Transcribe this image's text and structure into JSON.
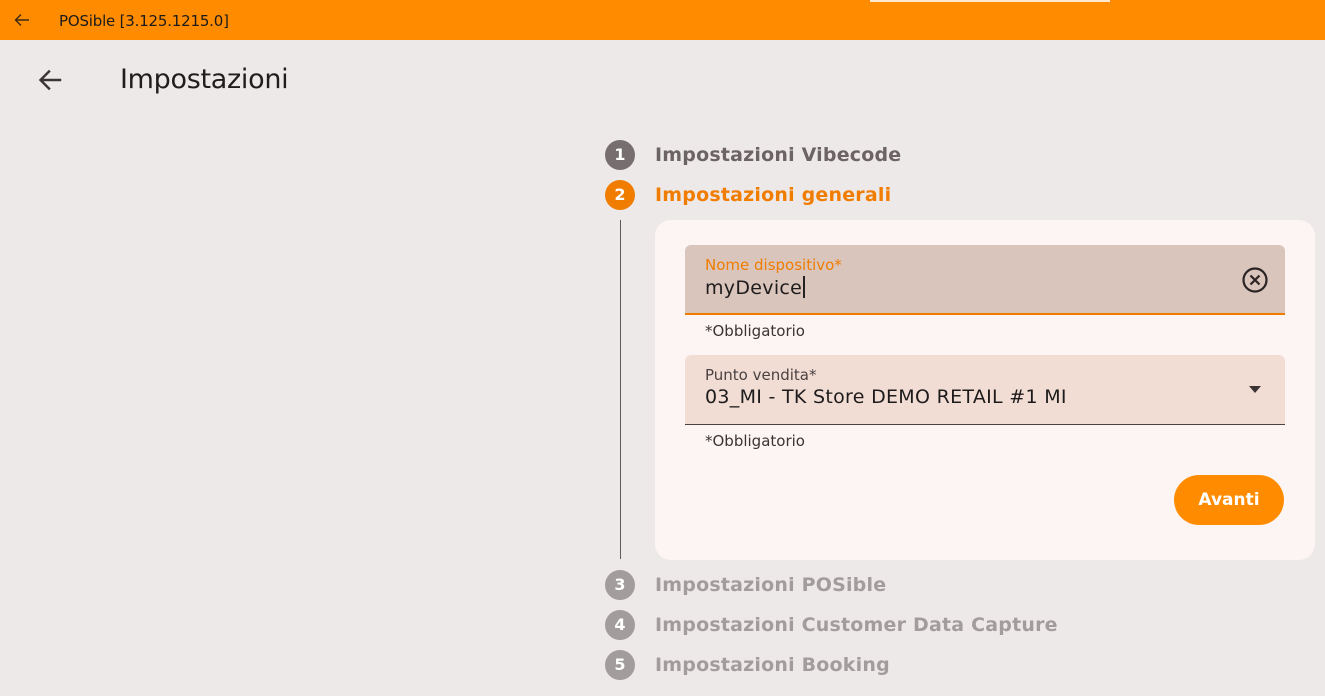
{
  "window": {
    "title": "POSible [3.125.1215.0]"
  },
  "header": {
    "title": "Impostazioni"
  },
  "steps": [
    {
      "number": "1",
      "label": "Impostazioni Vibecode",
      "state": "done"
    },
    {
      "number": "2",
      "label": "Impostazioni generali",
      "state": "active"
    },
    {
      "number": "3",
      "label": "Impostazioni POSible",
      "state": "pending"
    },
    {
      "number": "4",
      "label": "Impostazioni Customer Data Capture",
      "state": "pending"
    },
    {
      "number": "5",
      "label": "Impostazioni Booking",
      "state": "pending"
    }
  ],
  "form": {
    "device_name": {
      "label": "Nome dispositivo*",
      "value": "myDevice",
      "helper": "*Obbligatorio"
    },
    "store": {
      "label": "Punto vendita*",
      "value": "03_MI - TK Store DEMO RETAIL #1 MI",
      "helper": "*Obbligatorio"
    },
    "next_label": "Avanti"
  },
  "icons": {
    "titlebar_back": "arrow-left-icon",
    "header_back": "arrow-left-icon",
    "clear": "close-circle-icon",
    "dropdown": "caret-down-icon"
  },
  "colors": {
    "accent": "#FF8C00",
    "active_step": "#F07C00",
    "background": "#EEE9E9",
    "card": "#FDF5F4"
  }
}
